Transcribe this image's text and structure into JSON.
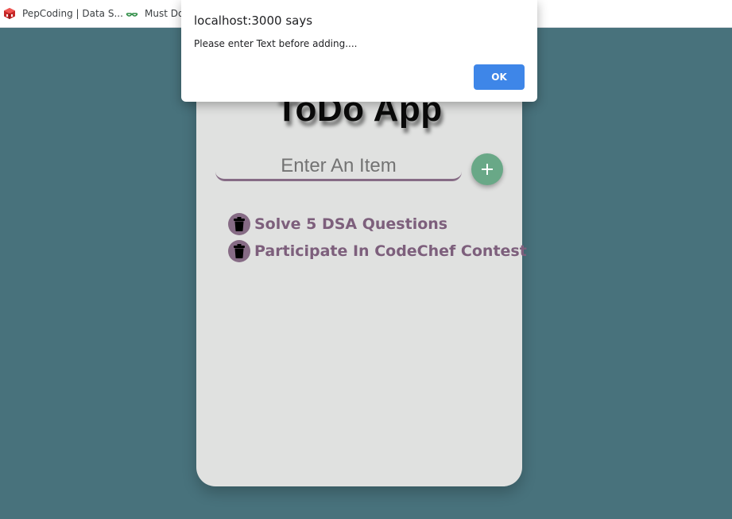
{
  "bookmarks": [
    {
      "label": "PepCoding | Data S...",
      "icon": "pepcoding-logo-icon"
    },
    {
      "label": "Must Do",
      "icon": "geeksforgeeks-logo-icon"
    }
  ],
  "app": {
    "title": "ToDo App",
    "input_placeholder": "Enter An Item",
    "add_icon": "plus-icon",
    "items": [
      {
        "text": "Solve 5 DSA Questions",
        "icon": "trash-icon"
      },
      {
        "text": "Participate In CodeChef Contest",
        "icon": "trash-icon"
      }
    ]
  },
  "dialog": {
    "title": "localhost:3000 says",
    "message": "Please enter Text before adding....",
    "ok_label": "OK"
  },
  "colors": {
    "background": "#48727c",
    "card": "#e0e1e0",
    "accent_purple": "#866b85",
    "add_button": "#69a887",
    "ok_button": "#3e86e8"
  }
}
